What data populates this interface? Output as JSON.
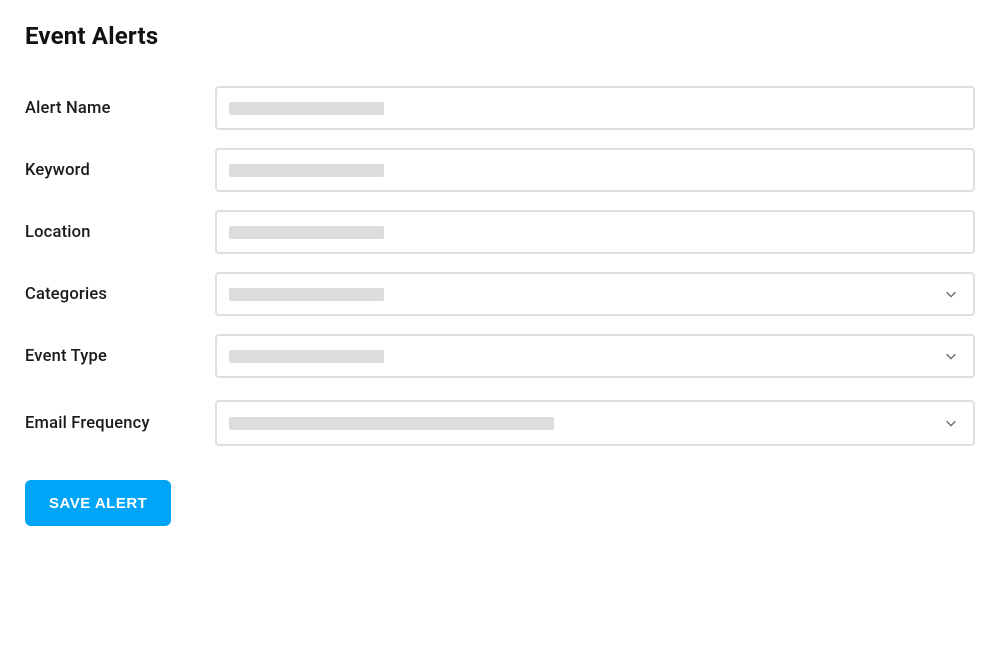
{
  "title": "Event Alerts",
  "fields": {
    "alert_name": {
      "label": "Alert Name",
      "value": "",
      "placeholder": ""
    },
    "keyword": {
      "label": "Keyword",
      "value": "",
      "placeholder": ""
    },
    "location": {
      "label": "Location",
      "value": "",
      "placeholder": ""
    },
    "categories": {
      "label": "Categories",
      "selected": "",
      "placeholder": ""
    },
    "event_type": {
      "label": "Event Type",
      "selected": "",
      "placeholder": ""
    },
    "email_frequency": {
      "label": "Email Frequency",
      "selected": "",
      "placeholder": ""
    }
  },
  "actions": {
    "save_label": "SAVE ALERT"
  },
  "colors": {
    "primary": "#00a5f7",
    "border": "#dfdfdf",
    "placeholder": "#dcdcdc"
  }
}
